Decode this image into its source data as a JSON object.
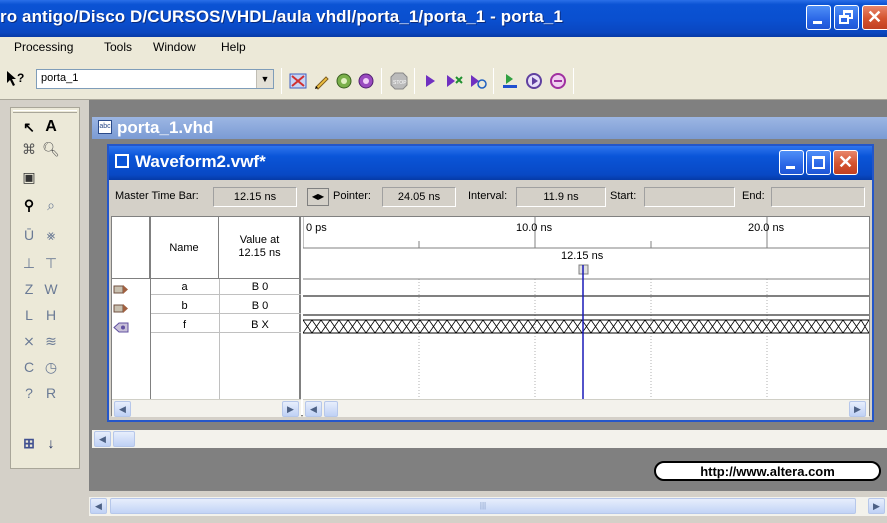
{
  "window": {
    "title": "ro antigo/Disco D/CURSOS/VHDL/aula vhdl/porta_1/porta_1 - porta_1"
  },
  "menu": {
    "items": [
      "Processing",
      "Tools",
      "Window",
      "Help"
    ]
  },
  "toolbar": {
    "project_combo_value": "porta_1"
  },
  "document_tab": {
    "title": "porta_1.vhd",
    "icon_text": "abc"
  },
  "waveform": {
    "title": "Waveform2.vwf*",
    "master_time_bar_label": "Master Time Bar:",
    "master_time_bar_value": "12.15 ns",
    "pointer_label": "Pointer:",
    "pointer_value": "24.05 ns",
    "interval_label": "Interval:",
    "interval_value": "11.9 ns",
    "start_label": "Start:",
    "start_value": "",
    "end_label": "End:",
    "end_value": "",
    "columns": {
      "name": "Name",
      "value_line1": "Value at",
      "value_line2": "12.15 ns"
    },
    "ruler": {
      "tick_0": "0 ps",
      "tick_10": "10.0 ns",
      "tick_20": "20.0 ns",
      "marker": "12.15 ns"
    },
    "signals": [
      {
        "name": "a",
        "value": "B 0",
        "dir": "input"
      },
      {
        "name": "b",
        "value": "B 0",
        "dir": "input"
      },
      {
        "name": "f",
        "value": "B X",
        "dir": "output"
      }
    ]
  },
  "footer": {
    "url": "http://www.altera.com"
  },
  "colors": {
    "xp_blue": "#0a55d8",
    "marker_line": "#1a1ab8",
    "close_red": "#d4532f"
  }
}
